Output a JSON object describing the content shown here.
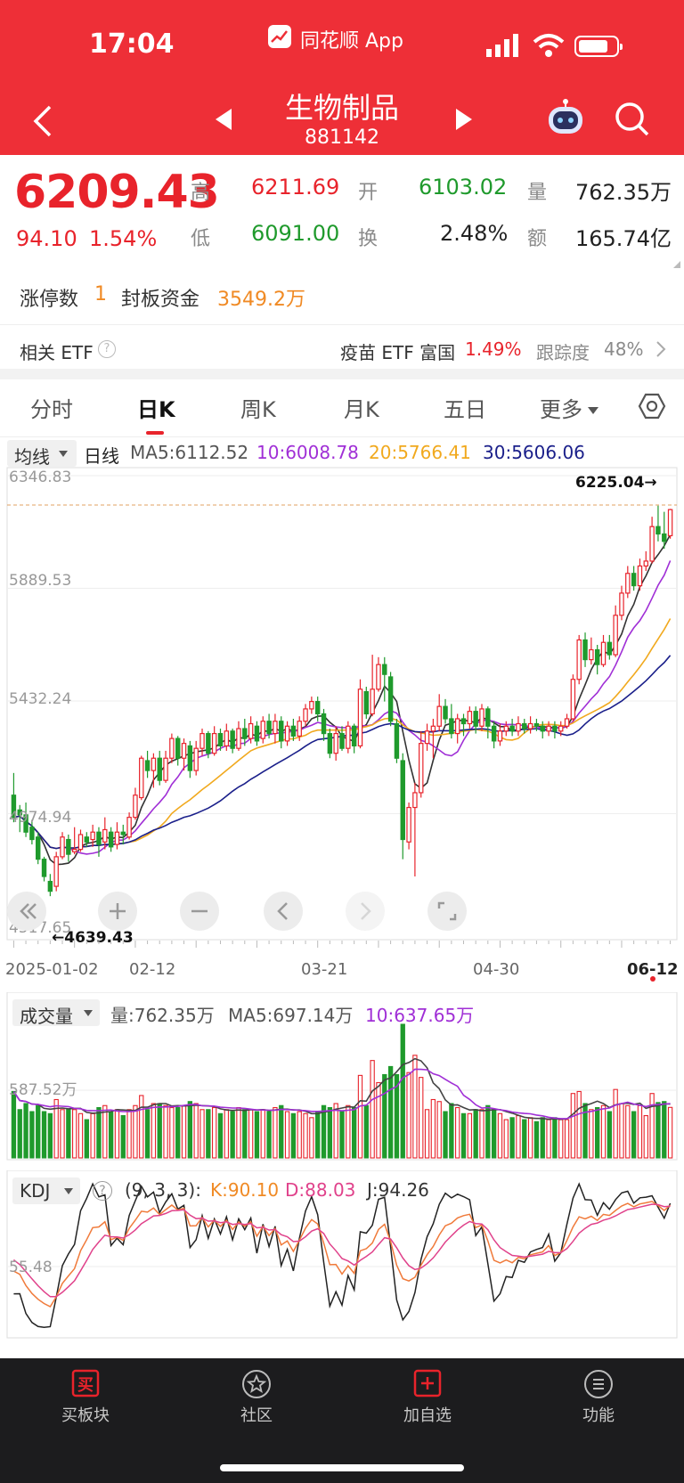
{
  "status_bar": {
    "time": "17:04",
    "app_name": "同花顺 App"
  },
  "header": {
    "title": "生物制品",
    "code": "881142"
  },
  "quote": {
    "price": "6209.43",
    "change": "94.10",
    "change_pct": "1.54%",
    "high_label": "高",
    "high": "6211.69",
    "low_label": "低",
    "low": "6091.00",
    "open_label": "开",
    "open": "6103.02",
    "turnover_label": "换",
    "turnover": "2.48%",
    "volume_label": "量",
    "volume": "762.35万",
    "amount_label": "额",
    "amount": "165.74亿"
  },
  "limit_up": {
    "label": "涨停数",
    "count": "1",
    "seal_label": "封板资金",
    "seal_amount": "3549.2万"
  },
  "etf": {
    "label": "相关 ETF",
    "name": "疫苗 ETF 富国",
    "pct": "1.49%",
    "track_label": "跟踪度",
    "track_pct": "48%"
  },
  "tabs": [
    "分时",
    "日K",
    "周K",
    "月K",
    "五日",
    "更多"
  ],
  "active_tab": 1,
  "ma_bar": {
    "selector": "均线",
    "period": "日线",
    "ma5": "MA5:6112.52",
    "ma10": "10:6008.78",
    "ma20": "20:5766.41",
    "ma30": "30:5606.06"
  },
  "kline": {
    "y_labels": [
      "6346.83",
      "5889.53",
      "5432.24",
      "4974.94",
      "4517.65"
    ],
    "max_marker": "6225.04→",
    "min_marker": "←4639.43",
    "x_labels": [
      "2025-01-02",
      "02-12",
      "03-21",
      "04-30",
      "06-12"
    ],
    "candles": [
      {
        "o": 5050,
        "c": 4960,
        "h": 5140,
        "l": 4940
      },
      {
        "o": 4990,
        "c": 4970,
        "h": 5010,
        "l": 4900
      },
      {
        "o": 4970,
        "c": 4900,
        "h": 5020,
        "l": 4880
      },
      {
        "o": 4920,
        "c": 4870,
        "h": 4950,
        "l": 4850
      },
      {
        "o": 4880,
        "c": 4790,
        "h": 4900,
        "l": 4770
      },
      {
        "o": 4790,
        "c": 4720,
        "h": 4800,
        "l": 4700
      },
      {
        "o": 4700,
        "c": 4660,
        "h": 4730,
        "l": 4640
      },
      {
        "o": 4680,
        "c": 4800,
        "h": 4820,
        "l": 4660
      },
      {
        "o": 4800,
        "c": 4880,
        "h": 4900,
        "l": 4790
      },
      {
        "o": 4870,
        "c": 4810,
        "h": 4890,
        "l": 4780
      },
      {
        "o": 4820,
        "c": 4830,
        "h": 4920,
        "l": 4810
      },
      {
        "o": 4830,
        "c": 4890,
        "h": 4910,
        "l": 4820
      },
      {
        "o": 4880,
        "c": 4860,
        "h": 4900,
        "l": 4840
      },
      {
        "o": 4870,
        "c": 4900,
        "h": 4930,
        "l": 4840
      },
      {
        "o": 4900,
        "c": 4850,
        "h": 4920,
        "l": 4800
      },
      {
        "o": 4860,
        "c": 4910,
        "h": 4960,
        "l": 4830
      },
      {
        "o": 4900,
        "c": 4840,
        "h": 4920,
        "l": 4820
      },
      {
        "o": 4850,
        "c": 4900,
        "h": 4940,
        "l": 4830
      },
      {
        "o": 4900,
        "c": 4890,
        "h": 4930,
        "l": 4850
      },
      {
        "o": 4880,
        "c": 4960,
        "h": 4980,
        "l": 4870
      },
      {
        "o": 4960,
        "c": 5050,
        "h": 5080,
        "l": 4950
      },
      {
        "o": 5040,
        "c": 5200,
        "h": 5210,
        "l": 5030
      },
      {
        "o": 5190,
        "c": 5150,
        "h": 5230,
        "l": 5120
      },
      {
        "o": 5150,
        "c": 5200,
        "h": 5220,
        "l": 5080
      },
      {
        "o": 5200,
        "c": 5110,
        "h": 5230,
        "l": 5090
      },
      {
        "o": 5110,
        "c": 5200,
        "h": 5230,
        "l": 5100
      },
      {
        "o": 5200,
        "c": 5280,
        "h": 5300,
        "l": 5180
      },
      {
        "o": 5280,
        "c": 5200,
        "h": 5290,
        "l": 5170
      },
      {
        "o": 5200,
        "c": 5260,
        "h": 5280,
        "l": 5150
      },
      {
        "o": 5250,
        "c": 5150,
        "h": 5270,
        "l": 5120
      },
      {
        "o": 5150,
        "c": 5240,
        "h": 5270,
        "l": 5130
      },
      {
        "o": 5240,
        "c": 5300,
        "h": 5320,
        "l": 5210
      },
      {
        "o": 5300,
        "c": 5220,
        "h": 5310,
        "l": 5200
      },
      {
        "o": 5220,
        "c": 5300,
        "h": 5330,
        "l": 5210
      },
      {
        "o": 5300,
        "c": 5250,
        "h": 5320,
        "l": 5230
      },
      {
        "o": 5250,
        "c": 5310,
        "h": 5340,
        "l": 5230
      },
      {
        "o": 5310,
        "c": 5240,
        "h": 5320,
        "l": 5220
      },
      {
        "o": 5240,
        "c": 5320,
        "h": 5350,
        "l": 5230
      },
      {
        "o": 5320,
        "c": 5280,
        "h": 5360,
        "l": 5250
      },
      {
        "o": 5280,
        "c": 5340,
        "h": 5370,
        "l": 5260
      },
      {
        "o": 5330,
        "c": 5270,
        "h": 5350,
        "l": 5250
      },
      {
        "o": 5280,
        "c": 5350,
        "h": 5370,
        "l": 5260
      },
      {
        "o": 5350,
        "c": 5300,
        "h": 5380,
        "l": 5280
      },
      {
        "o": 5300,
        "c": 5350,
        "h": 5380,
        "l": 5260
      },
      {
        "o": 5350,
        "c": 5270,
        "h": 5370,
        "l": 5240
      },
      {
        "o": 5270,
        "c": 5330,
        "h": 5350,
        "l": 5250
      },
      {
        "o": 5330,
        "c": 5290,
        "h": 5360,
        "l": 5270
      },
      {
        "o": 5290,
        "c": 5350,
        "h": 5370,
        "l": 5270
      },
      {
        "o": 5350,
        "c": 5400,
        "h": 5420,
        "l": 5330
      },
      {
        "o": 5400,
        "c": 5430,
        "h": 5450,
        "l": 5380
      },
      {
        "o": 5430,
        "c": 5380,
        "h": 5450,
        "l": 5350
      },
      {
        "o": 5380,
        "c": 5300,
        "h": 5400,
        "l": 5270
      },
      {
        "o": 5300,
        "c": 5220,
        "h": 5320,
        "l": 5200
      },
      {
        "o": 5220,
        "c": 5300,
        "h": 5330,
        "l": 5190
      },
      {
        "o": 5300,
        "c": 5240,
        "h": 5330,
        "l": 5230
      },
      {
        "o": 5240,
        "c": 5330,
        "h": 5350,
        "l": 5220
      },
      {
        "o": 5330,
        "c": 5250,
        "h": 5340,
        "l": 5220
      },
      {
        "o": 5250,
        "c": 5480,
        "h": 5520,
        "l": 5240
      },
      {
        "o": 5470,
        "c": 5380,
        "h": 5490,
        "l": 5360
      },
      {
        "o": 5380,
        "c": 5480,
        "h": 5620,
        "l": 5370
      },
      {
        "o": 5480,
        "c": 5580,
        "h": 5610,
        "l": 5470
      },
      {
        "o": 5580,
        "c": 5540,
        "h": 5610,
        "l": 5430
      },
      {
        "o": 5530,
        "c": 5350,
        "h": 5550,
        "l": 5330
      },
      {
        "o": 5340,
        "c": 5200,
        "h": 5360,
        "l": 5180
      },
      {
        "o": 5190,
        "c": 4870,
        "h": 5220,
        "l": 4790
      },
      {
        "o": 4860,
        "c": 5000,
        "h": 5020,
        "l": 4830
      },
      {
        "o": 5000,
        "c": 5060,
        "h": 5100,
        "l": 4720
      },
      {
        "o": 5060,
        "c": 5260,
        "h": 5310,
        "l": 5040
      },
      {
        "o": 5260,
        "c": 5310,
        "h": 5340,
        "l": 5230
      },
      {
        "o": 5310,
        "c": 5330,
        "h": 5360,
        "l": 5200
      },
      {
        "o": 5330,
        "c": 5410,
        "h": 5460,
        "l": 5310
      },
      {
        "o": 5410,
        "c": 5360,
        "h": 5440,
        "l": 5340
      },
      {
        "o": 5360,
        "c": 5300,
        "h": 5420,
        "l": 5280
      },
      {
        "o": 5300,
        "c": 5360,
        "h": 5380,
        "l": 5260
      },
      {
        "o": 5360,
        "c": 5340,
        "h": 5380,
        "l": 5290
      },
      {
        "o": 5340,
        "c": 5390,
        "h": 5410,
        "l": 5320
      },
      {
        "o": 5390,
        "c": 5330,
        "h": 5410,
        "l": 5300
      },
      {
        "o": 5330,
        "c": 5400,
        "h": 5420,
        "l": 5310
      },
      {
        "o": 5400,
        "c": 5330,
        "h": 5410,
        "l": 5280
      },
      {
        "o": 5330,
        "c": 5270,
        "h": 5350,
        "l": 5240
      },
      {
        "o": 5270,
        "c": 5310,
        "h": 5340,
        "l": 5250
      },
      {
        "o": 5310,
        "c": 5330,
        "h": 5350,
        "l": 5290
      },
      {
        "o": 5330,
        "c": 5310,
        "h": 5360,
        "l": 5290
      },
      {
        "o": 5310,
        "c": 5340,
        "h": 5370,
        "l": 5290
      },
      {
        "o": 5340,
        "c": 5320,
        "h": 5360,
        "l": 5300
      },
      {
        "o": 5320,
        "c": 5340,
        "h": 5370,
        "l": 5300
      },
      {
        "o": 5340,
        "c": 5330,
        "h": 5360,
        "l": 5310
      },
      {
        "o": 5330,
        "c": 5310,
        "h": 5350,
        "l": 5280
      },
      {
        "o": 5310,
        "c": 5330,
        "h": 5350,
        "l": 5290
      },
      {
        "o": 5330,
        "c": 5310,
        "h": 5350,
        "l": 5280
      },
      {
        "o": 5310,
        "c": 5330,
        "h": 5350,
        "l": 5290
      },
      {
        "o": 5330,
        "c": 5360,
        "h": 5380,
        "l": 5320
      },
      {
        "o": 5360,
        "c": 5520,
        "h": 5540,
        "l": 5350
      },
      {
        "o": 5520,
        "c": 5680,
        "h": 5700,
        "l": 5500
      },
      {
        "o": 5680,
        "c": 5600,
        "h": 5710,
        "l": 5570
      },
      {
        "o": 5600,
        "c": 5640,
        "h": 5690,
        "l": 5580
      },
      {
        "o": 5640,
        "c": 5580,
        "h": 5660,
        "l": 5540
      },
      {
        "o": 5580,
        "c": 5670,
        "h": 5700,
        "l": 5570
      },
      {
        "o": 5670,
        "c": 5620,
        "h": 5700,
        "l": 5600
      },
      {
        "o": 5620,
        "c": 5780,
        "h": 5820,
        "l": 5610
      },
      {
        "o": 5780,
        "c": 5870,
        "h": 5900,
        "l": 5760
      },
      {
        "o": 5870,
        "c": 5950,
        "h": 5980,
        "l": 5850
      },
      {
        "o": 5950,
        "c": 5900,
        "h": 5980,
        "l": 5880
      },
      {
        "o": 5900,
        "c": 5980,
        "h": 6010,
        "l": 5880
      },
      {
        "o": 5980,
        "c": 6000,
        "h": 6040,
        "l": 5960
      },
      {
        "o": 6000,
        "c": 6140,
        "h": 6180,
        "l": 5990
      },
      {
        "o": 6140,
        "c": 6110,
        "h": 6225,
        "l": 6080
      },
      {
        "o": 6110,
        "c": 6080,
        "h": 6200,
        "l": 6050
      },
      {
        "o": 6103,
        "c": 6209,
        "h": 6212,
        "l": 6091
      }
    ]
  },
  "volume": {
    "selector": "成交量",
    "vol": "量:762.35万",
    "ma5": "MA5:697.14万",
    "ma10": "10:637.65万",
    "y_label": "587.52万"
  },
  "kdj": {
    "selector": "KDJ",
    "params": "(9, 3, 3):",
    "k": "K:90.10",
    "d": "D:88.03",
    "j": "J:94.26",
    "y_label": "55.48"
  },
  "bottom_nav": [
    "买板块",
    "社区",
    "加自选",
    "功能"
  ],
  "colors": {
    "up": "#e8232b",
    "down": "#1f9a2c",
    "header": "#ee2f37",
    "ma5": "#333333",
    "ma10": "#a02fd6",
    "ma20": "#f1a91e",
    "ma30": "#1a1f8a"
  }
}
